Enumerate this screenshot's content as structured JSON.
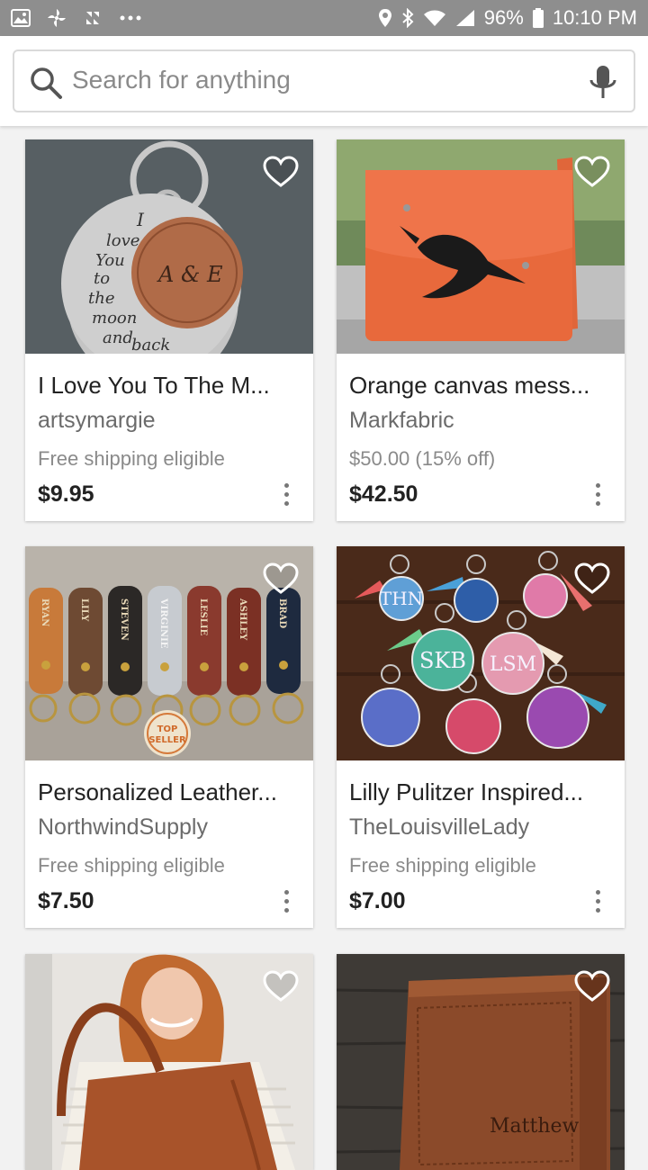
{
  "status_bar": {
    "battery": "96%",
    "time": "10:10 PM"
  },
  "search": {
    "placeholder": "Search for anything"
  },
  "listings": [
    {
      "title": "I Love You To The M...",
      "shop": "artsymargie",
      "shipping": "Free shipping eligible",
      "price": "$9.95",
      "image_text": [
        "I",
        "love",
        "You",
        "to",
        "the",
        "moon",
        "and",
        "back",
        "A & E"
      ]
    },
    {
      "title": "Orange canvas mess...",
      "shop": "Markfabric",
      "shipping": "$50.00 (15% off)",
      "price": "$42.50"
    },
    {
      "title": "Personalized Leather...",
      "shop": "NorthwindSupply",
      "shipping": "Free shipping eligible",
      "price": "$7.50",
      "image_text": [
        "RYAN",
        "LILY",
        "STEVEN",
        "VIRGINIE",
        "LESLIE",
        "ASHLEY",
        "BRAD"
      ],
      "badge": [
        "TOP",
        "SELLER"
      ]
    },
    {
      "title": "Lilly Pulitzer Inspired...",
      "shop": "TheLouisvilleLady",
      "shipping": "Free shipping eligible",
      "price": "$7.00",
      "image_text": [
        "THN",
        "SKB",
        "LSM"
      ]
    },
    {
      "title": "",
      "shop": "",
      "shipping": "",
      "price": ""
    },
    {
      "title": "",
      "shop": "",
      "shipping": "",
      "price": "",
      "image_text": [
        "Matthew"
      ]
    }
  ],
  "colors": {
    "status_bar": "#8e8e8e",
    "background": "#f2f2f2",
    "text_primary": "#222222",
    "text_secondary": "#6b6b6b"
  }
}
